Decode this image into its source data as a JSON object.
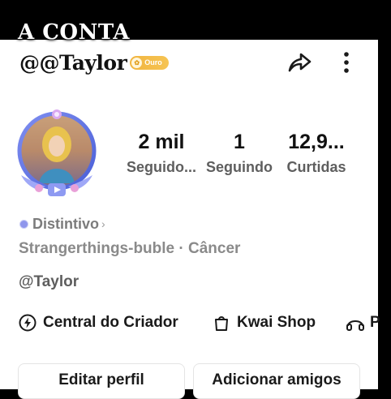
{
  "overlay_caption": "A CONTA",
  "profile": {
    "username": "@@Taylor",
    "badge_label": "Ouro",
    "colors": {
      "badge": "#f1b540",
      "distintivo_dot": "#8f96ec",
      "avatar_frame": "#6f7de8"
    }
  },
  "icons": {
    "share": "share-icon",
    "more": "more-vertical-icon"
  },
  "stats": [
    {
      "value": "2 mil",
      "label": "Seguido..."
    },
    {
      "value": "1",
      "label": "Seguindo"
    },
    {
      "value": "12,9...",
      "label": "Curtidas"
    }
  ],
  "distintivo": {
    "label": "Distintivo",
    "chevron": "›"
  },
  "bio": "Strangerthings-buble · Câncer",
  "handle": "@Taylor",
  "quick_links": [
    {
      "label": "Central do Criador",
      "icon": "lightning-circle-icon"
    },
    {
      "label": "Kwai Shop",
      "icon": "shopping-bag-icon"
    },
    {
      "label": "",
      "icon": "headphones-icon"
    }
  ],
  "buttons": {
    "edit_profile": "Editar perfil",
    "add_friends": "Adicionar amigos"
  }
}
